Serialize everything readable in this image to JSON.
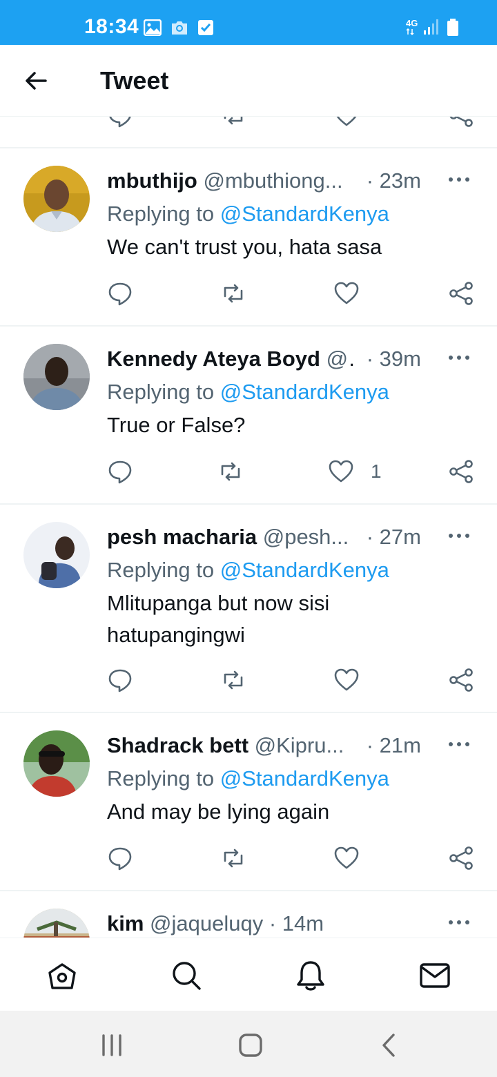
{
  "status_bar": {
    "time": "18:34",
    "network": "4G",
    "icons": [
      "gallery-icon",
      "camera-icon",
      "check-icon",
      "signal-icon",
      "battery-icon"
    ]
  },
  "header": {
    "title": "Tweet",
    "back_icon": "arrow-left-icon"
  },
  "colors": {
    "status_bar": "#1da1f2",
    "accent": "#1d9bf0",
    "text_primary": "#0f1419",
    "text_secondary": "#536471",
    "divider": "#eff3f4"
  },
  "tweets": [
    {
      "name": "mbuthijo",
      "handle": "@mbuthiong...",
      "time": "· 23m",
      "replying_prefix": "Replying to",
      "replying_to": "@StandardKenya",
      "text": "We can't trust you, hata sasa",
      "like_count": ""
    },
    {
      "name": "Kennedy Ateya Boyd",
      "handle": "@.",
      "time": "· 39m",
      "replying_prefix": "Replying to",
      "replying_to": "@StandardKenya",
      "text": "True or False?",
      "like_count": "1"
    },
    {
      "name": "pesh macharia",
      "handle": "@pesh...",
      "time": "· 27m",
      "replying_prefix": "Replying to",
      "replying_to": "@StandardKenya",
      "text": "Mlitupanga but now sisi hatupangingwi",
      "like_count": ""
    },
    {
      "name": "Shadrack bett",
      "handle": "@Kipru...",
      "time": "· 21m",
      "replying_prefix": "Replying to",
      "replying_to": "@StandardKenya",
      "text": "And may be lying again",
      "like_count": ""
    },
    {
      "name": "kim",
      "handle": "@jaqueluqy",
      "time": "· 14m"
    }
  ],
  "bottom_nav": [
    "home-icon",
    "search-icon",
    "notifications-icon",
    "messages-icon"
  ],
  "system_nav": [
    "recent-apps-icon",
    "home-button-icon",
    "back-icon"
  ]
}
